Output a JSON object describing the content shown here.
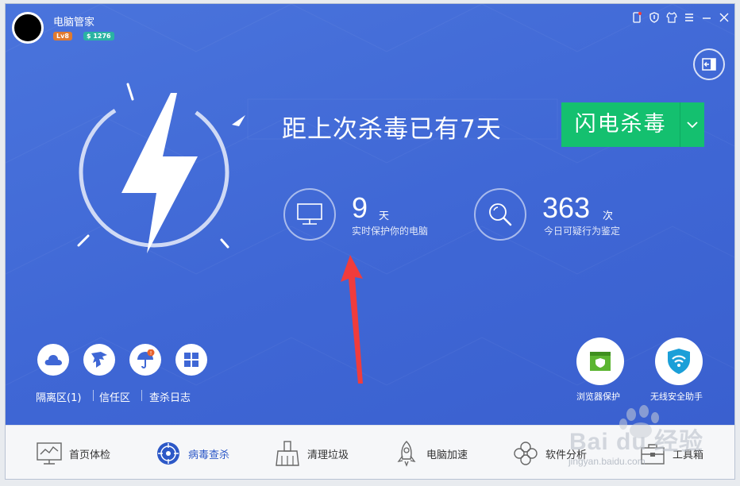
{
  "header": {
    "title": "电脑管家",
    "level_badge": "Lv8",
    "coin_badge": "$ 1276"
  },
  "main": {
    "headline": "距上次杀毒已有7天",
    "scan_button": "闪电杀毒",
    "stats": [
      {
        "number": "9",
        "unit": "天",
        "label": "实时保护你的电脑",
        "icon": "monitor-icon"
      },
      {
        "number": "363",
        "unit": "次",
        "label": "今日可疑行为鉴定",
        "icon": "magnifier-icon"
      }
    ],
    "tools": [
      {
        "label": "隔离区(1)",
        "icon": "cloud-icon"
      },
      {
        "label": "信任区",
        "icon": "eagle-icon"
      },
      {
        "label": "查杀日志",
        "icon": "umbrella-icon"
      },
      {
        "icon": "windows-icon"
      }
    ],
    "right_tools": [
      {
        "label": "浏览器保护",
        "icon": "browser-shield-icon"
      },
      {
        "label": "无线安全助手",
        "icon": "wifi-shield-icon"
      }
    ]
  },
  "nav": {
    "items": [
      {
        "label": "首页体检",
        "icon": "monitor-chart-icon"
      },
      {
        "label": "病毒查杀",
        "icon": "target-icon",
        "active": true
      },
      {
        "label": "清理垃圾",
        "icon": "broom-icon"
      },
      {
        "label": "电脑加速",
        "icon": "rocket-icon"
      },
      {
        "label": "软件分析",
        "icon": "clover-icon"
      },
      {
        "label": "工具箱",
        "icon": "toolbox-icon"
      }
    ]
  },
  "watermark": {
    "text1": "Bai du 经验",
    "text2": "jingyan.baidu.com"
  },
  "colors": {
    "background": "#3f67d5",
    "accent_green": "#14c06f",
    "active_nav": "#2c58c7",
    "arrow_red": "#f03c3c"
  }
}
